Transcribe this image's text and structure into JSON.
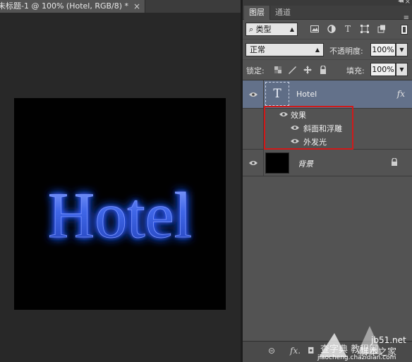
{
  "document": {
    "tab_title": "未标题-1 @ 100% (Hotel, RGB/8) *",
    "tab_close": "×",
    "canvas_text": "Hotel"
  },
  "panel": {
    "tabs": [
      {
        "label": "图层",
        "active": true
      },
      {
        "label": "通道",
        "active": false
      }
    ],
    "collapse_glyph": "◂◂",
    "close_glyph": "×",
    "menu_glyph": "≡",
    "filter": {
      "kind_label": "类型",
      "icons": [
        "image-filter-icon",
        "adjustment-filter-icon",
        "text-filter-icon",
        "shape-filter-icon",
        "smart-object-filter-icon"
      ]
    },
    "blend_mode": "正常",
    "opacity_label": "不透明度:",
    "opacity_value": "100%",
    "lock_label": "锁定:",
    "fill_label": "填充:",
    "fill_value": "100%",
    "layers": [
      {
        "name": "Hotel",
        "type": "text",
        "thumb": "T",
        "fx": "fx",
        "selected": true
      },
      {
        "name": "背景",
        "type": "background",
        "locked": true
      }
    ],
    "effects": {
      "group_label": "效果",
      "items": [
        "斜面和浮雕",
        "外发光"
      ]
    },
    "bottom_bar": {
      "link": "⊝",
      "fx": "fx.",
      "mask": "◘"
    }
  },
  "watermark": {
    "line1": "jb51.net",
    "line2": "脚本之家",
    "line3": "查字典 教程网",
    "line4": "jiaocheng.chazidian.com"
  },
  "colors": {
    "selection_highlight": "#63718a",
    "effects_outline": "#cf1a1a",
    "glow_blue": "#2f5cff"
  }
}
